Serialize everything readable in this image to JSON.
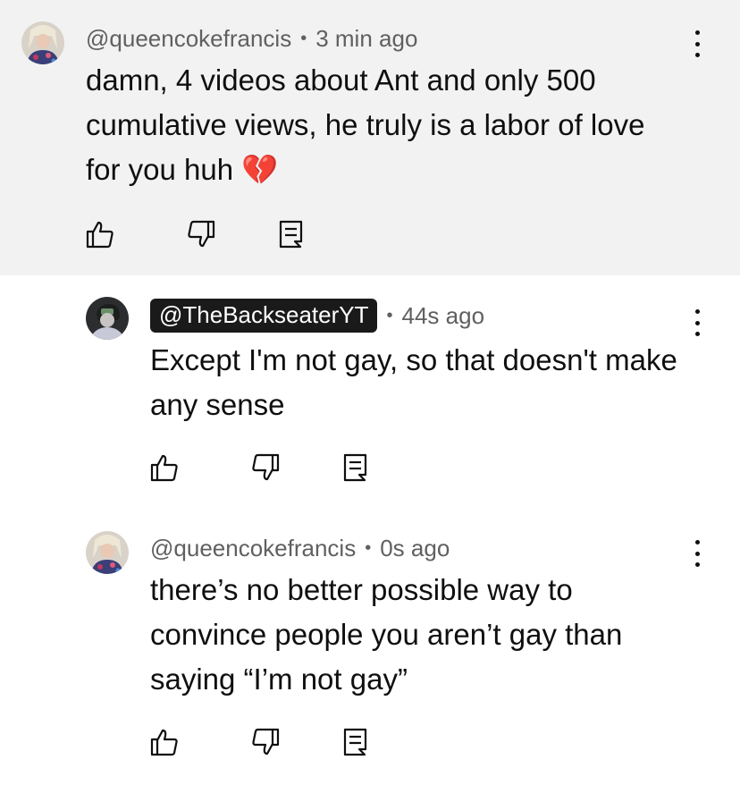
{
  "comments": [
    {
      "author": "@queencokefrancis",
      "time": "3 min ago",
      "dot": "•",
      "text": "damn, 4 videos about Ant and only 500 cumulative views, he truly is a labor of love for you huh 💔"
    },
    {
      "author": "@TheBackseaterYT",
      "time": "44s ago",
      "dot": "•",
      "text": "Except I'm not gay, so that doesn't make any sense"
    },
    {
      "author": "@queencokefrancis",
      "time": "0s ago",
      "dot": "•",
      "text": "there’s no better possible way to convince people you aren’t gay than saying “I’m not gay”"
    }
  ],
  "icons": {
    "like": "thumbs-up-icon",
    "dislike": "thumbs-down-icon",
    "reply": "reply-icon",
    "more": "more-vertical-icon"
  },
  "colors": {
    "highlight_bg": "#f2f2f2",
    "meta_text": "#606060",
    "chip_bg": "#1a1a1a"
  }
}
